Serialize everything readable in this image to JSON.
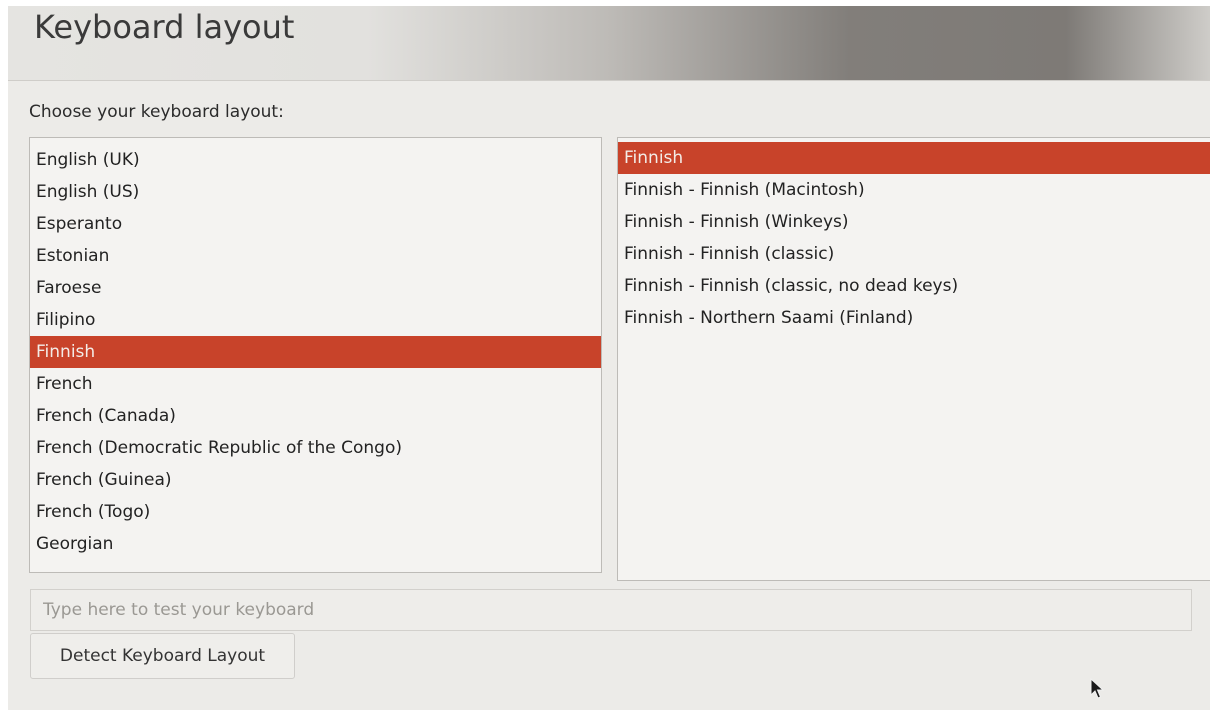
{
  "header": {
    "title": "Keyboard layout"
  },
  "main": {
    "prompt": "Choose your keyboard layout:",
    "layouts": [
      {
        "label": "English (UK)",
        "selected": false
      },
      {
        "label": "English (US)",
        "selected": false
      },
      {
        "label": "Esperanto",
        "selected": false
      },
      {
        "label": "Estonian",
        "selected": false
      },
      {
        "label": "Faroese",
        "selected": false
      },
      {
        "label": "Filipino",
        "selected": false
      },
      {
        "label": "Finnish",
        "selected": true
      },
      {
        "label": "French",
        "selected": false
      },
      {
        "label": "French (Canada)",
        "selected": false
      },
      {
        "label": "French (Democratic Republic of the Congo)",
        "selected": false
      },
      {
        "label": "French (Guinea)",
        "selected": false
      },
      {
        "label": "French (Togo)",
        "selected": false
      },
      {
        "label": "Georgian",
        "selected": false
      }
    ],
    "variants": [
      {
        "label": "Finnish",
        "selected": true
      },
      {
        "label": "Finnish - Finnish (Macintosh)",
        "selected": false
      },
      {
        "label": "Finnish - Finnish (Winkeys)",
        "selected": false
      },
      {
        "label": "Finnish - Finnish (classic)",
        "selected": false
      },
      {
        "label": "Finnish - Finnish (classic, no dead keys)",
        "selected": false
      },
      {
        "label": "Finnish - Northern Saami (Finland)",
        "selected": false
      }
    ],
    "test_input": {
      "value": "",
      "placeholder": "Type here to test your keyboard"
    },
    "detect_button_label": "Detect Keyboard Layout"
  },
  "colors": {
    "selection": "#c8432a",
    "background": "#ecebe8"
  },
  "icons": {
    "pointer": "mouse-pointer-icon"
  }
}
